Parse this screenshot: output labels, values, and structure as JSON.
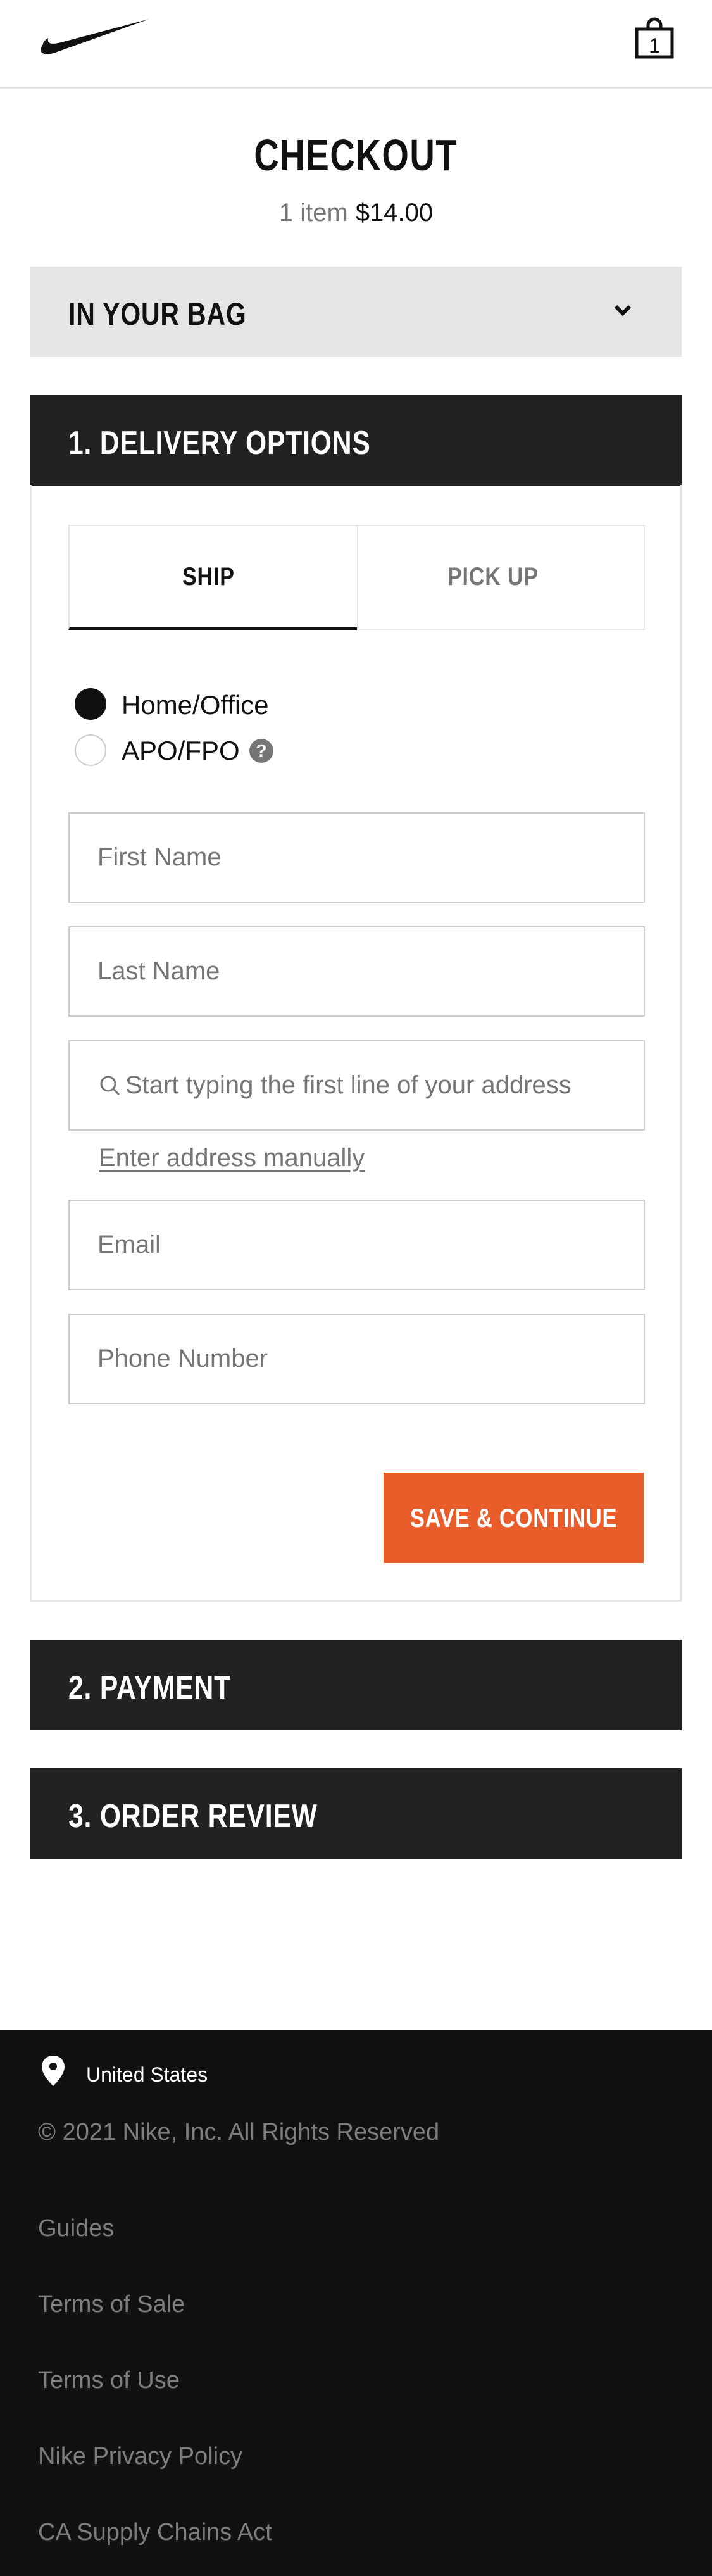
{
  "header": {
    "logo_name": "nike-swoosh-icon",
    "bag_icon_name": "shopping-bag-icon",
    "bag_count": "1"
  },
  "checkout": {
    "title": "CHECKOUT",
    "item_count": "1 item",
    "total": "$14.00"
  },
  "bag_section": {
    "label": "IN YOUR BAG",
    "chevron_icon": "chevron-down-icon"
  },
  "delivery": {
    "label": "1. DELIVERY OPTIONS",
    "tabs": [
      {
        "label": "SHIP",
        "active": true
      },
      {
        "label": "PICK UP",
        "active": false
      }
    ],
    "address_types": [
      {
        "label": "Home/Office",
        "selected": true
      },
      {
        "label": "APO/FPO",
        "selected": false
      }
    ],
    "help_icon": "?",
    "fields": {
      "first_name_placeholder": "First Name",
      "last_name_placeholder": "Last Name",
      "address_placeholder": "Start typing the first line of your address",
      "email_placeholder": "Email",
      "phone_placeholder": "Phone Number"
    },
    "manual_address_link": "Enter address manually",
    "save_button": "SAVE & CONTINUE"
  },
  "payment": {
    "label": "2. PAYMENT"
  },
  "order_review": {
    "label": "3. ORDER REVIEW"
  },
  "footer": {
    "pin_icon": "location-pin-icon",
    "country": "United States",
    "copyright": "© 2021 Nike, Inc. All Rights Reserved",
    "links": [
      "Guides",
      "Terms of Sale",
      "Terms of Use",
      "Nike Privacy Policy",
      "CA Supply Chains Act"
    ]
  },
  "colors": {
    "accent": "#e95d2a",
    "dark_bar": "#222222",
    "light_bar": "#e5e5e5",
    "footer_bg": "#111111"
  }
}
